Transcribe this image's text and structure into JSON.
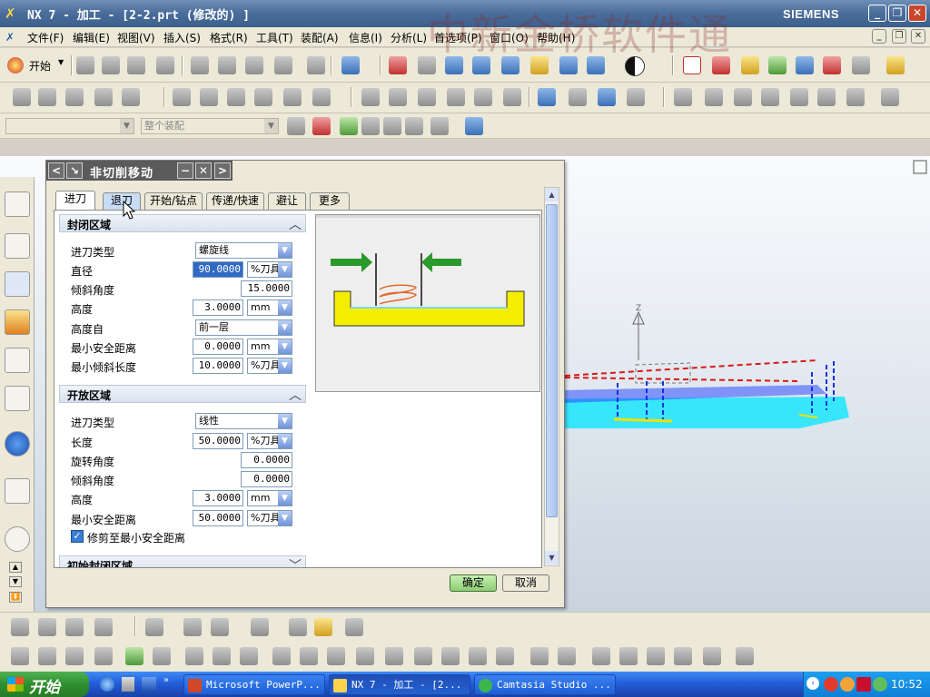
{
  "window": {
    "title": "NX 7 - 加工 - [2-2.prt  (修改的) ]",
    "brand": "SIEMENS",
    "watermark": "中新金桥软件通",
    "controls": [
      "_",
      "❐",
      "✕"
    ]
  },
  "menubar": {
    "items": [
      "文件(F)",
      "编辑(E)",
      "视图(V)",
      "插入(S)",
      "格式(R)",
      "工具(T)",
      "装配(A)",
      "信息(I)",
      "分析(L)",
      "首选项(P)",
      "窗口(O)",
      "帮助(H)"
    ]
  },
  "toolbar": {
    "start_label": "开始",
    "filter_placeholder": "整个装配"
  },
  "dialog": {
    "title": "非切削移动",
    "tabs": [
      {
        "label": "进刀",
        "state": "active"
      },
      {
        "label": "退刀",
        "state": "hover"
      },
      {
        "label": "开始/钻点",
        "state": ""
      },
      {
        "label": "传递/快速",
        "state": ""
      },
      {
        "label": "避让",
        "state": ""
      },
      {
        "label": "更多",
        "state": ""
      }
    ],
    "closed_area": {
      "header": "封闭区域",
      "engage_type_label": "进刀类型",
      "engage_type_value": "螺旋线",
      "diameter_label": "直径",
      "diameter_value": "90.0000",
      "diameter_unit": "%刀具",
      "ramp_angle_label": "倾斜角度",
      "ramp_angle_value": "15.0000",
      "height_label": "高度",
      "height_value": "3.0000",
      "height_unit": "mm",
      "height_from_label": "高度自",
      "height_from_value": "前一层",
      "min_clearance_label": "最小安全距离",
      "min_clearance_value": "0.0000",
      "min_clearance_unit": "mm",
      "min_ramp_len_label": "最小倾斜长度",
      "min_ramp_len_value": "10.0000",
      "min_ramp_len_unit": "%刀具"
    },
    "open_area": {
      "header": "开放区域",
      "engage_type_label": "进刀类型",
      "engage_type_value": "线性",
      "length_label": "长度",
      "length_value": "50.0000",
      "length_unit": "%刀具",
      "rotation_label": "旋转角度",
      "rotation_value": "0.0000",
      "ramp_angle_label": "倾斜角度",
      "ramp_angle_value": "0.0000",
      "height_label": "高度",
      "height_value": "3.0000",
      "height_unit": "mm",
      "min_clearance_label": "最小安全距离",
      "min_clearance_value": "50.0000",
      "min_clearance_unit": "%刀具",
      "trim_checkbox_label": "修剪至最小安全距离",
      "trim_checked": true
    },
    "next_section_header": "初始封闭区域",
    "ok_label": "确定",
    "cancel_label": "取消"
  },
  "taskbar": {
    "start_label": "开始",
    "tasks": [
      {
        "label": "Microsoft PowerP...",
        "active": false
      },
      {
        "label": "NX 7 - 加工 - [2...",
        "active": true
      },
      {
        "label": "Camtasia Studio ...",
        "active": false
      }
    ],
    "clock": "10:52"
  },
  "colors": {
    "title_bar": "#4b6e9c",
    "taskbar": "#245edb",
    "start_green": "#2f8f2f",
    "ok_button": "#9fd68a",
    "preview_yellow": "#ffef00",
    "preview_arrow": "#2a9a2a",
    "preview_spiral": "#e26a2c"
  }
}
